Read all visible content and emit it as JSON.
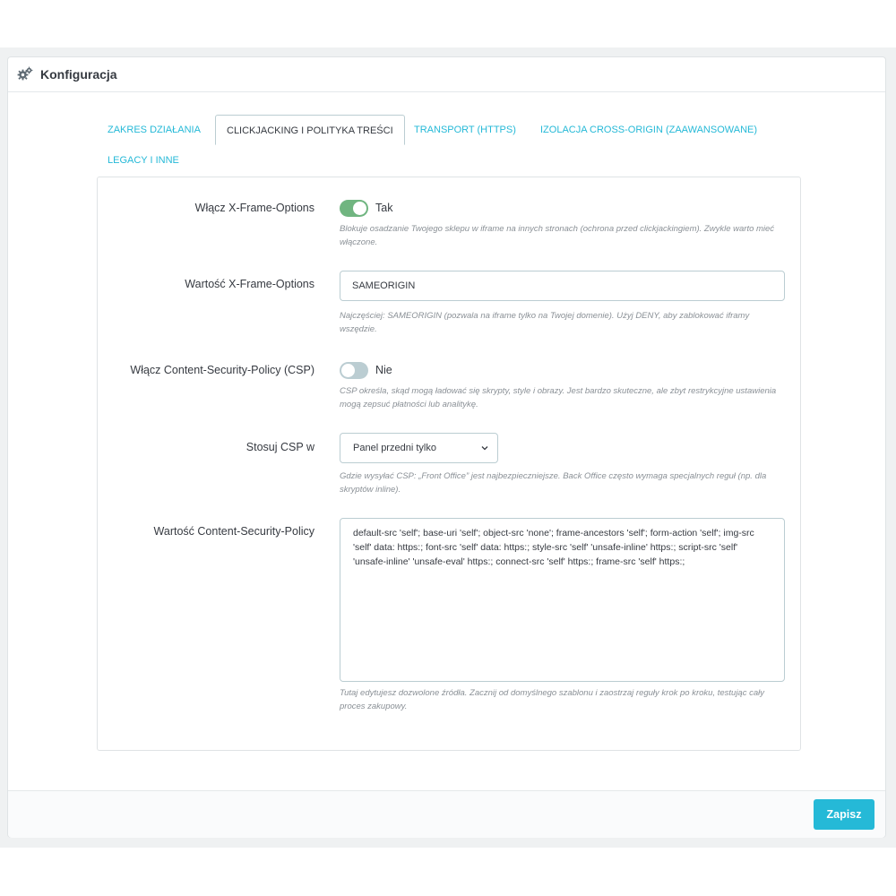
{
  "panel": {
    "title": "Konfiguracja",
    "icon": "gears-icon"
  },
  "tabs": [
    {
      "label": "ZAKRES DZIAŁANIA",
      "active": false
    },
    {
      "label": "CLICKJACKING I POLITYKA TREŚCI",
      "active": true
    },
    {
      "label": "TRANSPORT (HTTPS)",
      "active": false
    },
    {
      "label": "IZOLACJA CROSS-ORIGIN (ZAAWANSOWANE)",
      "active": false
    },
    {
      "label": "LEGACY I INNE",
      "active": false
    }
  ],
  "form": {
    "xfo_enable": {
      "label": "Włącz X-Frame-Options",
      "state": true,
      "state_label": "Tak",
      "help": "Blokuje osadzanie Twojego sklepu w iframe na innych stronach (ochrona przed clickjackingiem). Zwykle warto mieć włączone."
    },
    "xfo_value": {
      "label": "Wartość X-Frame-Options",
      "value": "SAMEORIGIN",
      "help": "Najczęściej: SAMEORIGIN (pozwala na iframe tylko na Twojej domenie). Użyj DENY, aby zablokować iframy wszędzie."
    },
    "csp_enable": {
      "label": "Włącz Content-Security-Policy (CSP)",
      "state": false,
      "state_label": "Nie",
      "help": "CSP określa, skąd mogą ładować się skrypty, style i obrazy. Jest bardzo skuteczne, ale zbyt restrykcyjne ustawienia mogą zepsuć płatności lub analitykę."
    },
    "csp_scope": {
      "label": "Stosuj CSP w",
      "selected": "Panel przedni tylko",
      "help": "Gdzie wysyłać CSP: „Front Office” jest najbezpieczniejsze. Back Office często wymaga specjalnych reguł (np. dla skryptów inline)."
    },
    "csp_value": {
      "label": "Wartość Content-Security-Policy",
      "value": "default-src 'self'; base-uri 'self'; object-src 'none'; frame-ancestors 'self'; form-action 'self'; img-src 'self' data: https:; font-src 'self' data: https:; style-src 'self' 'unsafe-inline' https:; script-src 'self' 'unsafe-inline' 'unsafe-eval' https:; connect-src 'self' https:; frame-src 'self' https:;",
      "help": "Tutaj edytujesz dozwolone źródła. Zacznij od domyślnego szablonu i zaostrzaj reguły krok po kroku, testując cały proces zakupowy."
    }
  },
  "footer": {
    "save_label": "Zapisz"
  },
  "colors": {
    "accent": "#25b9d7",
    "switch_on": "#70b580",
    "switch_off": "#bbcdd2"
  }
}
